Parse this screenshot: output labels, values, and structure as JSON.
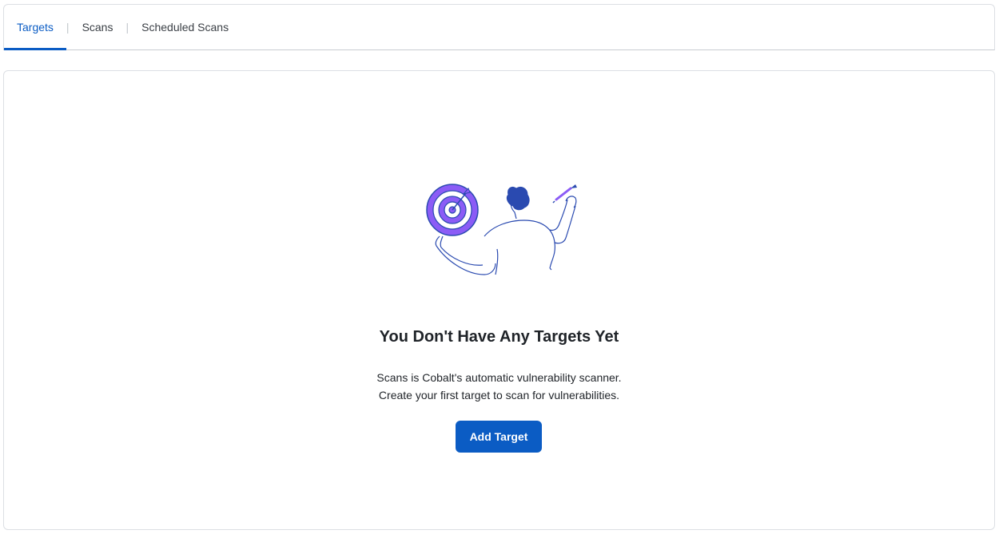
{
  "tabs": [
    {
      "label": "Targets",
      "active": true
    },
    {
      "label": "Scans",
      "active": false
    },
    {
      "label": "Scheduled Scans",
      "active": false
    }
  ],
  "tab_separator": "|",
  "empty_state": {
    "illustration_icon": "person-with-dartboard-illustration",
    "title": "You Don't Have Any Targets Yet",
    "description_line1": "Scans is Cobalt's automatic vulnerability scanner.",
    "description_line2": "Create your first target to scan for vulnerabilities.",
    "button_label": "Add Target"
  },
  "colors": {
    "accent": "#0b5cc4",
    "illustration_purple": "#8b5cf6",
    "illustration_stroke": "#2a4ab0"
  }
}
